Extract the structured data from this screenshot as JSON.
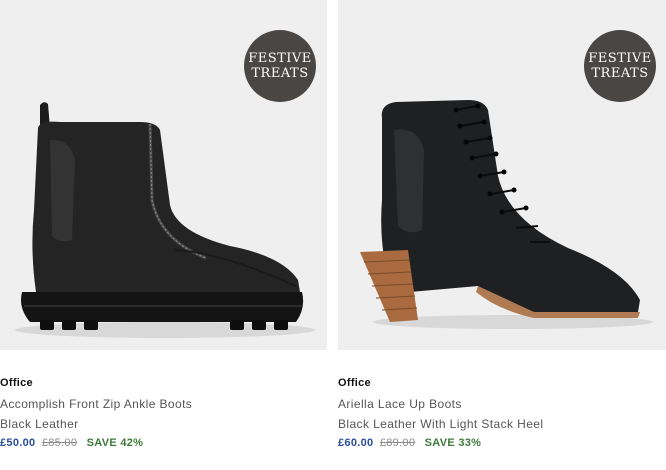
{
  "products": [
    {
      "brand": "Office",
      "name": "Accomplish Front Zip Ankle Boots",
      "colour": "Black Leather",
      "price_now": "£50.00",
      "price_was": "£85.00",
      "save": "SAVE 42%",
      "badge_line1": "FESTIVE",
      "badge_line2": "TREATS"
    },
    {
      "brand": "Office",
      "name": "Ariella Lace Up Boots",
      "colour": "Black Leather With Light Stack Heel",
      "price_now": "£60.00",
      "price_was": "£89.00",
      "save": "SAVE 33%",
      "badge_line1": "FESTIVE",
      "badge_line2": "TREATS"
    }
  ],
  "colors": {
    "price_now": "#2a4f9e",
    "save": "#3d7a3a",
    "badge_bg": "#4a4644",
    "image_bg": "#efefef"
  }
}
